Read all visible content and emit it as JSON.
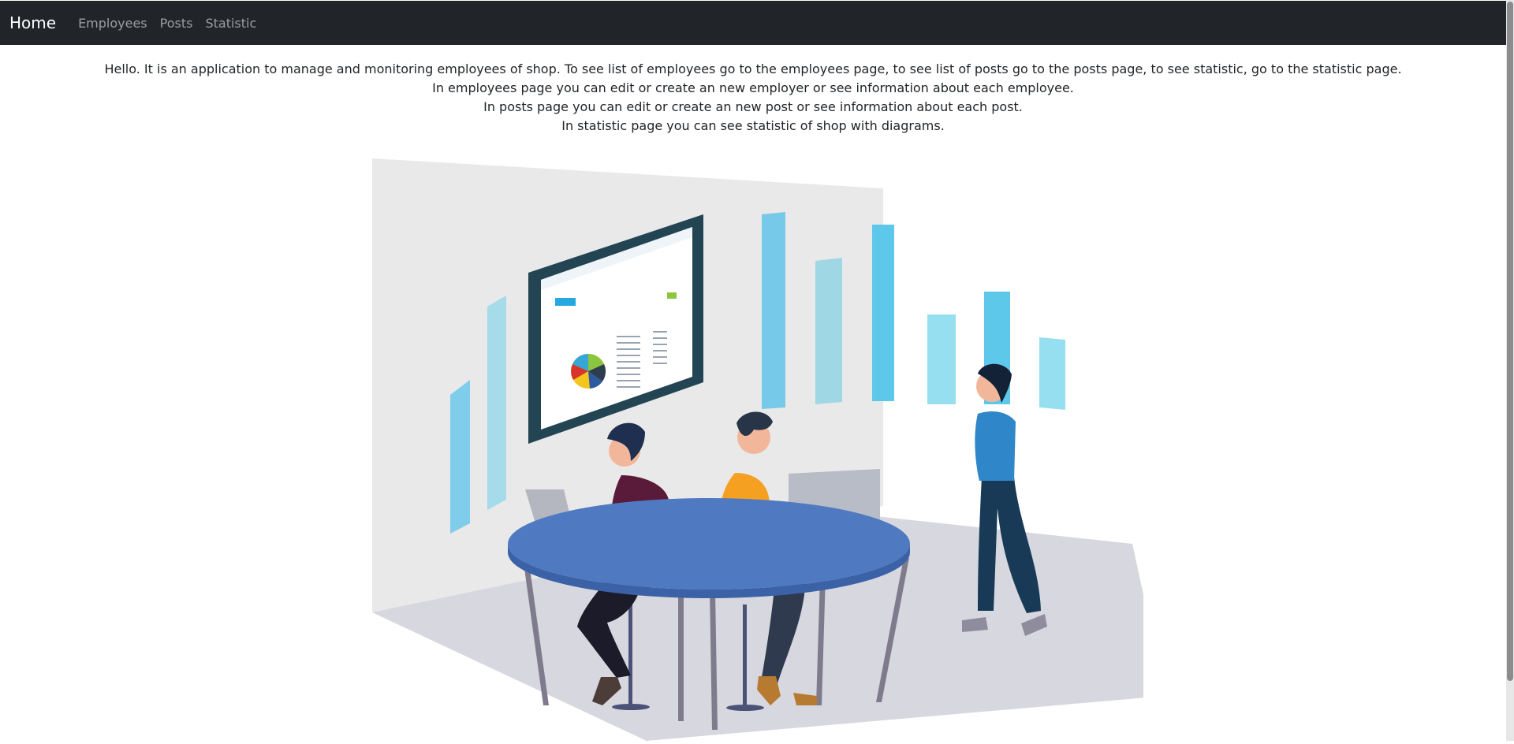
{
  "navbar": {
    "brand": "Home",
    "links": [
      "Employees",
      "Posts",
      "Statistic"
    ]
  },
  "intro": {
    "lines": [
      "Hello. It is an application to manage and monitoring employees of shop. To see list of employees go to the employees page, to see list of posts go to the posts page, to see statistic, go to the statistic page.",
      "In employees page you can edit or create an new employer or see information about each employee.",
      "In posts page you can edit or create an new post or see information about each post.",
      "In statistic page you can see statistic of shop with diagrams."
    ]
  },
  "colors": {
    "navbar_bg": "#212529",
    "table_blue": "#4f7ac2",
    "accent_cyan": "#5bc8e8"
  },
  "illustration": {
    "subject": "team-working-with-dashboard",
    "icon": "office-illustration"
  }
}
